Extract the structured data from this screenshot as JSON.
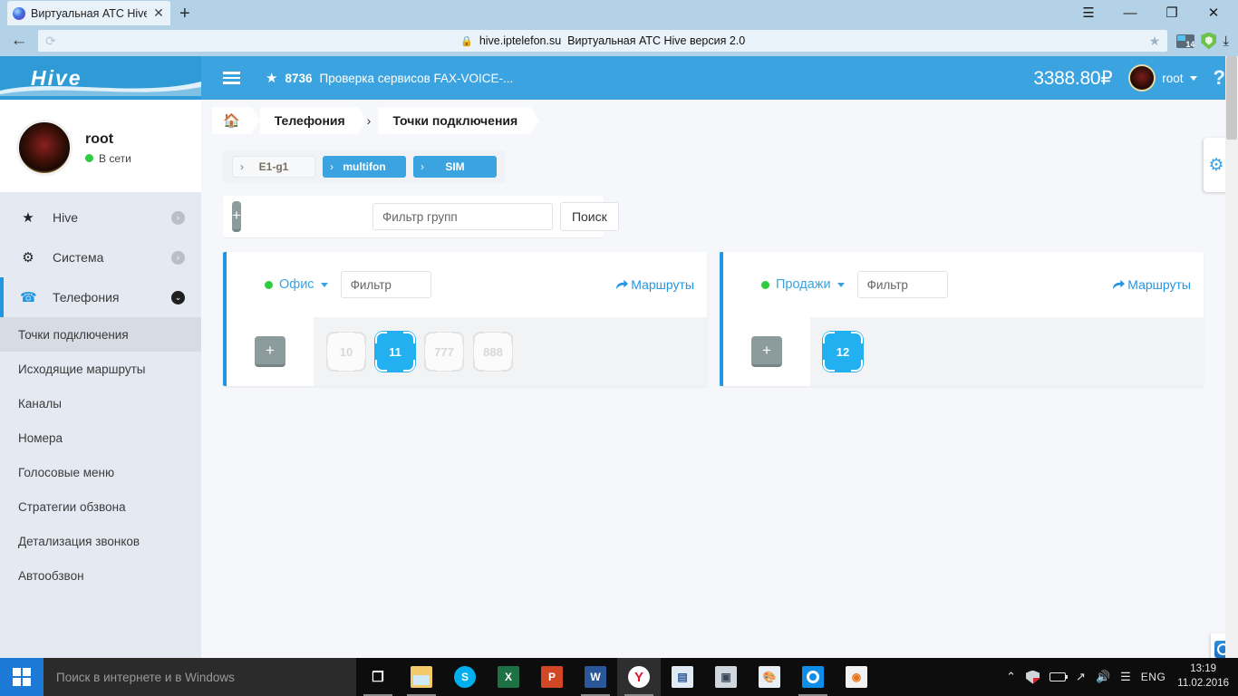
{
  "browser": {
    "tab": {
      "title": "Виртуальная АТС Hive ве",
      "favicon": "globe-icon",
      "close": "✕"
    },
    "new_tab": "+",
    "window_controls": {
      "menu": "☰",
      "minimize": "—",
      "maximize": "❐",
      "close": "✕"
    },
    "back": "←",
    "reload": "⟳",
    "address": {
      "lock": "🔒",
      "host": "hive.iptelefon.su",
      "description": "Виртуальная АТС Hive версия 2.0",
      "star": "★"
    },
    "extensions": {
      "mail_badge": "14",
      "shield": "shield-icon",
      "download": "⤓"
    }
  },
  "appbar": {
    "brand": "Hive",
    "menu_icon": "hamburger-icon",
    "star_icon": "★",
    "account_code": "8736",
    "account_title": "Проверка сервисов FAX-VOICE-...",
    "balance": "3388.80₽",
    "user": "root",
    "help": "?",
    "accent_color": "#3aa3e0"
  },
  "sidebar": {
    "profile": {
      "name": "root",
      "status": "В сети",
      "status_color": "#2ecc40"
    },
    "items": [
      {
        "label": "Hive",
        "icon": "star-icon",
        "chevron": "›",
        "active": false
      },
      {
        "label": "Система",
        "icon": "gears-icon",
        "chevron": "›",
        "active": false
      },
      {
        "label": "Телефония",
        "icon": "phone-icon",
        "chevron": "⌄",
        "active": true
      }
    ],
    "subitems": [
      {
        "label": "Точки подключения",
        "active": true
      },
      {
        "label": "Исходящие маршруты",
        "active": false
      },
      {
        "label": "Каналы",
        "active": false
      },
      {
        "label": "Номера",
        "active": false
      },
      {
        "label": "Голосовые меню",
        "active": false
      },
      {
        "label": "Стратегии обзвона",
        "active": false
      },
      {
        "label": "Детализация звонков",
        "active": false
      },
      {
        "label": "Автообзвон",
        "active": false
      }
    ]
  },
  "breadcrumb": {
    "home_icon": "home-icon",
    "items": [
      "Телефония",
      "Точки подключения"
    ],
    "separator": "›"
  },
  "tabs": [
    {
      "label": "E1-g1",
      "chevron": "›",
      "active": false
    },
    {
      "label": "multifon",
      "chevron": "›",
      "active": true
    },
    {
      "label": "SIM",
      "chevron": "›",
      "active": true
    }
  ],
  "toolbar": {
    "add_label": "+",
    "group_filter_placeholder": "Фильтр групп",
    "search_label": "Поиск"
  },
  "groups": [
    {
      "name": "Офис",
      "status_color": "#2ecc40",
      "filter_placeholder": "Фильтр",
      "routes_label": "Маршруты",
      "add_label": "+",
      "extensions": [
        {
          "number": "10",
          "active": false
        },
        {
          "number": "11",
          "active": true
        },
        {
          "number": "777",
          "active": false
        },
        {
          "number": "888",
          "active": false
        }
      ]
    },
    {
      "name": "Продажи",
      "status_color": "#2ecc40",
      "filter_placeholder": "Фильтр",
      "routes_label": "Маршруты",
      "add_label": "+",
      "extensions": [
        {
          "number": "12",
          "active": true
        }
      ]
    }
  ],
  "edge_widgets": {
    "gear": "gear-icon",
    "teamviewer": "teamviewer-icon"
  },
  "taskbar": {
    "start": "windows-logo",
    "search_placeholder": "Поиск в интернете и в Windows",
    "apps": [
      {
        "name": "task-view",
        "glyph": "❐",
        "cls": "taskview",
        "active": false,
        "running": false
      },
      {
        "name": "file-explorer",
        "glyph": "",
        "cls": "folder",
        "active": false,
        "running": true
      },
      {
        "name": "skype",
        "glyph": "S",
        "cls": "skype",
        "active": false,
        "running": false
      },
      {
        "name": "excel",
        "glyph": "X",
        "cls": "excel",
        "active": false,
        "running": false
      },
      {
        "name": "powerpoint",
        "glyph": "P",
        "cls": "ppt",
        "active": false,
        "running": false
      },
      {
        "name": "word",
        "glyph": "W",
        "cls": "word",
        "active": false,
        "running": true
      },
      {
        "name": "yandex-browser",
        "glyph": "Y",
        "cls": "yandex",
        "active": true,
        "running": true
      },
      {
        "name": "contacts",
        "glyph": "▤",
        "cls": "contacts",
        "active": false,
        "running": false
      },
      {
        "name": "monitor",
        "glyph": "▣",
        "cls": "monitor",
        "active": false,
        "running": false
      },
      {
        "name": "paint",
        "glyph": "🎨",
        "cls": "paint",
        "active": false,
        "running": false
      },
      {
        "name": "teamviewer",
        "glyph": "",
        "cls": "teamviewer",
        "active": false,
        "running": true
      },
      {
        "name": "app",
        "glyph": "◉",
        "cls": "orange",
        "active": false,
        "running": false
      }
    ],
    "tray": {
      "chevron": "⌃",
      "shield": "shield-icon",
      "battery": "battery-icon",
      "wifi": "wifi-icon",
      "volume": "🔊",
      "action_center": "notification-icon",
      "language": "ENG"
    },
    "clock": {
      "time": "13:19",
      "date": "11.02.2016"
    }
  }
}
